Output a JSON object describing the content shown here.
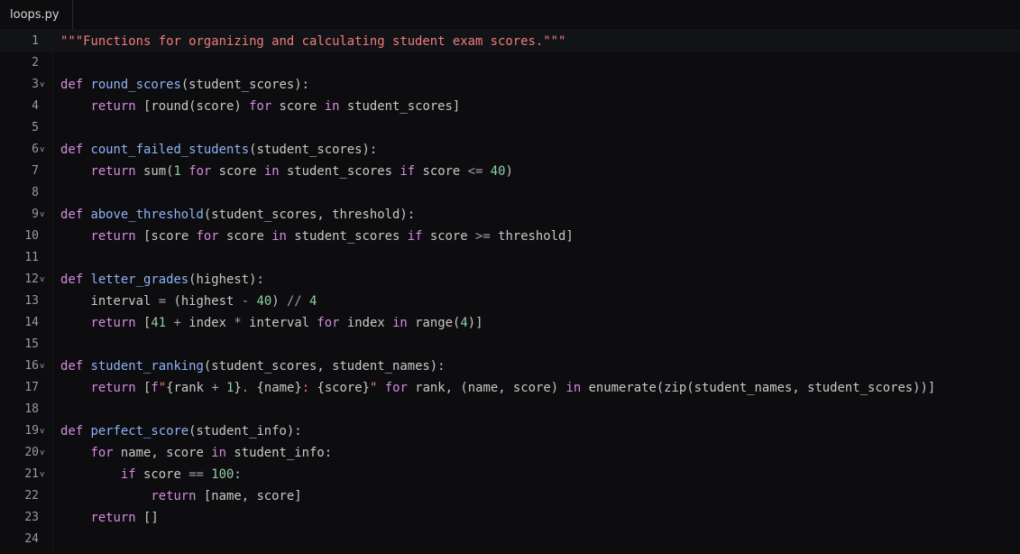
{
  "tab": {
    "label": "loops.py"
  },
  "fold_glyph": "v",
  "lines": [
    {
      "n": "1",
      "fold": false,
      "tokens": [
        [
          "str",
          "\"\"\"Functions for organizing and calculating student exam scores.\"\"\""
        ]
      ]
    },
    {
      "n": "2",
      "fold": false,
      "tokens": []
    },
    {
      "n": "3",
      "fold": true,
      "tokens": [
        [
          "kw",
          "def "
        ],
        [
          "fn",
          "round_scores"
        ],
        [
          "pl",
          "(student_scores):"
        ]
      ]
    },
    {
      "n": "4",
      "fold": false,
      "tokens": [
        [
          "pl",
          "    "
        ],
        [
          "kw",
          "return "
        ],
        [
          "pl",
          "[round(score) "
        ],
        [
          "kw",
          "for "
        ],
        [
          "pl",
          "score "
        ],
        [
          "kw",
          "in "
        ],
        [
          "pl",
          "student_scores]"
        ]
      ]
    },
    {
      "n": "5",
      "fold": false,
      "tokens": []
    },
    {
      "n": "6",
      "fold": true,
      "tokens": [
        [
          "kw",
          "def "
        ],
        [
          "fn",
          "count_failed_students"
        ],
        [
          "pl",
          "(student_scores):"
        ]
      ]
    },
    {
      "n": "7",
      "fold": false,
      "tokens": [
        [
          "pl",
          "    "
        ],
        [
          "kw",
          "return "
        ],
        [
          "pl",
          "sum("
        ],
        [
          "num",
          "1"
        ],
        [
          "pl",
          " "
        ],
        [
          "kw",
          "for "
        ],
        [
          "pl",
          "score "
        ],
        [
          "kw",
          "in "
        ],
        [
          "pl",
          "student_scores "
        ],
        [
          "kw",
          "if "
        ],
        [
          "pl",
          "score "
        ],
        [
          "op",
          "<= "
        ],
        [
          "num",
          "40"
        ],
        [
          "pl",
          ")"
        ]
      ]
    },
    {
      "n": "8",
      "fold": false,
      "tokens": []
    },
    {
      "n": "9",
      "fold": true,
      "tokens": [
        [
          "kw",
          "def "
        ],
        [
          "fn",
          "above_threshold"
        ],
        [
          "pl",
          "(student_scores, threshold):"
        ]
      ]
    },
    {
      "n": "10",
      "fold": false,
      "tokens": [
        [
          "pl",
          "    "
        ],
        [
          "kw",
          "return "
        ],
        [
          "pl",
          "[score "
        ],
        [
          "kw",
          "for "
        ],
        [
          "pl",
          "score "
        ],
        [
          "kw",
          "in "
        ],
        [
          "pl",
          "student_scores "
        ],
        [
          "kw",
          "if "
        ],
        [
          "pl",
          "score "
        ],
        [
          "op",
          ">= "
        ],
        [
          "pl",
          "threshold]"
        ]
      ]
    },
    {
      "n": "11",
      "fold": false,
      "tokens": []
    },
    {
      "n": "12",
      "fold": true,
      "tokens": [
        [
          "kw",
          "def "
        ],
        [
          "fn",
          "letter_grades"
        ],
        [
          "pl",
          "(highest):"
        ]
      ]
    },
    {
      "n": "13",
      "fold": false,
      "tokens": [
        [
          "pl",
          "    interval "
        ],
        [
          "op",
          "= "
        ],
        [
          "pl",
          "(highest "
        ],
        [
          "op",
          "- "
        ],
        [
          "num",
          "40"
        ],
        [
          "pl",
          ") "
        ],
        [
          "op",
          "// "
        ],
        [
          "num",
          "4"
        ]
      ]
    },
    {
      "n": "14",
      "fold": false,
      "tokens": [
        [
          "pl",
          "    "
        ],
        [
          "kw",
          "return "
        ],
        [
          "pl",
          "["
        ],
        [
          "num",
          "41"
        ],
        [
          "pl",
          " "
        ],
        [
          "op",
          "+ "
        ],
        [
          "pl",
          "index "
        ],
        [
          "op",
          "* "
        ],
        [
          "pl",
          "interval "
        ],
        [
          "kw",
          "for "
        ],
        [
          "pl",
          "index "
        ],
        [
          "kw",
          "in "
        ],
        [
          "pl",
          "range("
        ],
        [
          "num",
          "4"
        ],
        [
          "pl",
          ")]"
        ]
      ]
    },
    {
      "n": "15",
      "fold": false,
      "tokens": []
    },
    {
      "n": "16",
      "fold": true,
      "tokens": [
        [
          "kw",
          "def "
        ],
        [
          "fn",
          "student_ranking"
        ],
        [
          "pl",
          "(student_scores, student_names):"
        ]
      ]
    },
    {
      "n": "17",
      "fold": false,
      "tokens": [
        [
          "pl",
          "    "
        ],
        [
          "kw",
          "return "
        ],
        [
          "pl",
          "["
        ],
        [
          "kw",
          "f"
        ],
        [
          "str",
          "\""
        ],
        [
          "pl",
          "{rank "
        ],
        [
          "op",
          "+ "
        ],
        [
          "num",
          "1"
        ],
        [
          "pl",
          "}"
        ],
        [
          "str",
          ". "
        ],
        [
          "pl",
          "{name}"
        ],
        [
          "str",
          ": "
        ],
        [
          "pl",
          "{score}"
        ],
        [
          "str",
          "\""
        ],
        [
          "pl",
          " "
        ],
        [
          "kw",
          "for "
        ],
        [
          "pl",
          "rank, (name, score) "
        ],
        [
          "kw",
          "in "
        ],
        [
          "pl",
          "enumerate(zip(student_names, student_scores))]"
        ]
      ]
    },
    {
      "n": "18",
      "fold": false,
      "tokens": []
    },
    {
      "n": "19",
      "fold": true,
      "tokens": [
        [
          "kw",
          "def "
        ],
        [
          "fn",
          "perfect_score"
        ],
        [
          "pl",
          "(student_info):"
        ]
      ]
    },
    {
      "n": "20",
      "fold": true,
      "tokens": [
        [
          "pl",
          "    "
        ],
        [
          "kw",
          "for "
        ],
        [
          "pl",
          "name, score "
        ],
        [
          "kw",
          "in "
        ],
        [
          "pl",
          "student_info:"
        ]
      ]
    },
    {
      "n": "21",
      "fold": true,
      "tokens": [
        [
          "pl",
          "        "
        ],
        [
          "kw",
          "if "
        ],
        [
          "pl",
          "score "
        ],
        [
          "op",
          "== "
        ],
        [
          "num",
          "100"
        ],
        [
          "pl",
          ":"
        ]
      ]
    },
    {
      "n": "22",
      "fold": false,
      "tokens": [
        [
          "pl",
          "            "
        ],
        [
          "kw",
          "return "
        ],
        [
          "pl",
          "[name, score]"
        ]
      ]
    },
    {
      "n": "23",
      "fold": false,
      "tokens": [
        [
          "pl",
          "    "
        ],
        [
          "kw",
          "return "
        ],
        [
          "pl",
          "[]"
        ]
      ]
    },
    {
      "n": "24",
      "fold": false,
      "tokens": []
    }
  ]
}
